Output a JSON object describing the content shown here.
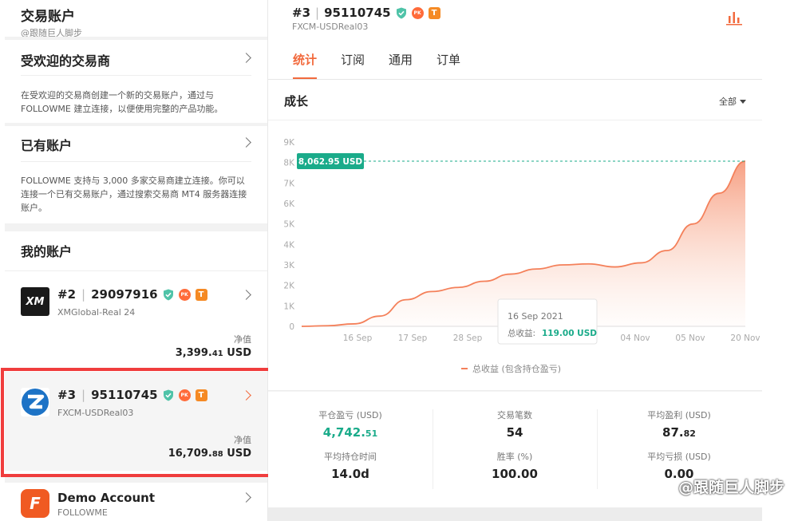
{
  "sidebar": {
    "title": "交易账户",
    "subtitle": "@跟随巨人脚步",
    "popular": {
      "heading": "受欢迎的交易商",
      "desc": "在受欢迎的交易商创建一个新的交易账户，通过与 FOLLOWME 建立连接，以便使用完整的产品功能。"
    },
    "existing": {
      "heading": "已有账户",
      "desc": "FOLLOWME 支持与 3,000 多家交易商建立连接。你可以连接一个已有交易账户，通过搜索交易商 MT4 服务器连接账户。"
    },
    "my_accounts_heading": "我的账户",
    "accounts": [
      {
        "num": "#2",
        "id": "29097916",
        "server": "XMGlobal-Real 24",
        "equity_label": "净值",
        "equity_main": "3,399.",
        "equity_dec": "41",
        "currency": " USD",
        "logo_text": "XM"
      },
      {
        "num": "#3",
        "id": "95110745",
        "server": "FXCM-USDReal03",
        "equity_label": "净值",
        "equity_main": "16,709.",
        "equity_dec": "88",
        "currency": " USD",
        "logo_text": "Z"
      },
      {
        "num": "",
        "id": "Demo Account",
        "server": "FOLLOWME",
        "logo_text": "F"
      }
    ]
  },
  "main": {
    "account_num": "#3",
    "account_id": "95110745",
    "server": "FXCM-USDReal03",
    "badge_fire": "PK",
    "badge_t": "T",
    "tabs": [
      "统计",
      "订阅",
      "通用",
      "订单"
    ],
    "card_title": "成长",
    "filter": "全部",
    "stats": [
      {
        "label": "平仓盈亏 (USD)",
        "main": "4,742.",
        "dec": "51"
      },
      {
        "label": "交易笔数",
        "main": "54",
        "dec": ""
      },
      {
        "label": "平均盈利 (USD)",
        "main": "87.",
        "dec": "82"
      },
      {
        "label": "平均持仓时间",
        "main": "14.0d",
        "dec": ""
      },
      {
        "label": "胜率 (%)",
        "main": "100.00",
        "dec": ""
      },
      {
        "label": "平均亏损 (USD)",
        "main": "0.00",
        "dec": ""
      }
    ]
  },
  "chart_data": {
    "type": "area",
    "y_ticks": [
      "0",
      "1K",
      "2K",
      "3K",
      "4K",
      "5K",
      "6K",
      "7K",
      "8K",
      "9K"
    ],
    "x_ticks": [
      "16 Sep",
      "17 Sep",
      "28 Sep",
      "04 Nov",
      "05 Nov",
      "20 Nov"
    ],
    "ylim": [
      0,
      9000
    ],
    "legend": "总收益 (包含持仓盈亏)",
    "highlight_label": "8,062.95 USD",
    "highlight_value": 8062.95,
    "tooltip": {
      "date": "16 Sep 2021",
      "label": "总收益:",
      "value": "119.00 USD"
    },
    "series": [
      {
        "values": [
          0,
          30,
          120,
          500,
          1300,
          1700,
          1900,
          2200,
          2550,
          2800,
          3000,
          3050,
          2900,
          3100,
          3700,
          5000,
          6500,
          8062.95
        ]
      }
    ],
    "colors": {
      "line": "#f4805a",
      "fill": "#fbd0bd",
      "accent": "#1aab8a"
    }
  }
}
